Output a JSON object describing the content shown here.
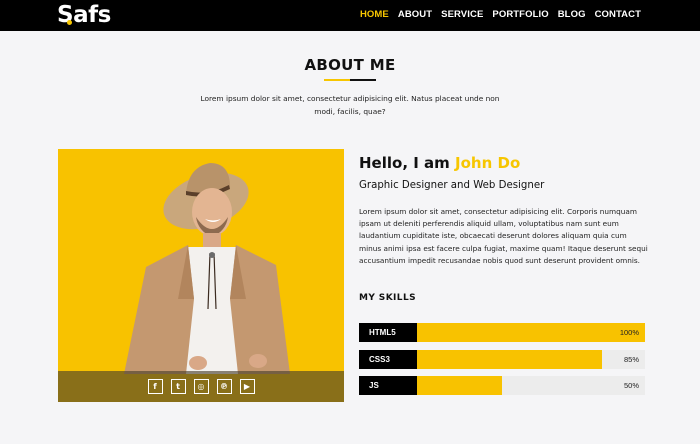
{
  "brand": {
    "name": "Safs",
    "accent_color": "#f7c600"
  },
  "nav": {
    "items": [
      {
        "label": "HOME",
        "active": true
      },
      {
        "label": "ABOUT",
        "active": false
      },
      {
        "label": "SERVICE",
        "active": false
      },
      {
        "label": "PORTFOLIO",
        "active": false
      },
      {
        "label": "BLOG",
        "active": false
      },
      {
        "label": "CONTACT",
        "active": false
      }
    ]
  },
  "about": {
    "title": "ABOUT ME",
    "intro": "Lorem ipsum dolor sit amet, consectetur adipisicing elit. Natus placeat unde non modi, facilis, quae?"
  },
  "profile": {
    "greeting": "Hello, I am",
    "name": "John Do",
    "role": "Graphic Designer and Web Designer",
    "bio": "Lorem ipsum dolor sit amet, consectetur adipisicing elit. Corporis numquam ipsam ut deleniti perferendis aliquid ullam, voluptatibus nam sunt eum laudantium cupiditate iste, obcaecati deserunt dolores aliquam quia cum minus animi ipsa est facere culpa fugiat, maxime quam! Itaque deserunt sequi accusantium impedit recusandae nobis quod sunt deserunt provident omnis.",
    "photo_bg_color": "#f8c200"
  },
  "social": [
    {
      "icon": "facebook-icon",
      "glyph": "f"
    },
    {
      "icon": "twitter-icon",
      "glyph": "t"
    },
    {
      "icon": "instagram-icon",
      "glyph": "◎"
    },
    {
      "icon": "pinterest-icon",
      "glyph": "℗"
    },
    {
      "icon": "youtube-icon",
      "glyph": "▶"
    }
  ],
  "skills": {
    "title": "MY SKILLS",
    "items": [
      {
        "label": "HTML5",
        "percent": 100,
        "percent_label": "100%"
      },
      {
        "label": "CSS3",
        "percent": 85,
        "percent_label": "85%"
      },
      {
        "label": "JS",
        "percent": 50,
        "percent_label": "50%"
      }
    ]
  }
}
